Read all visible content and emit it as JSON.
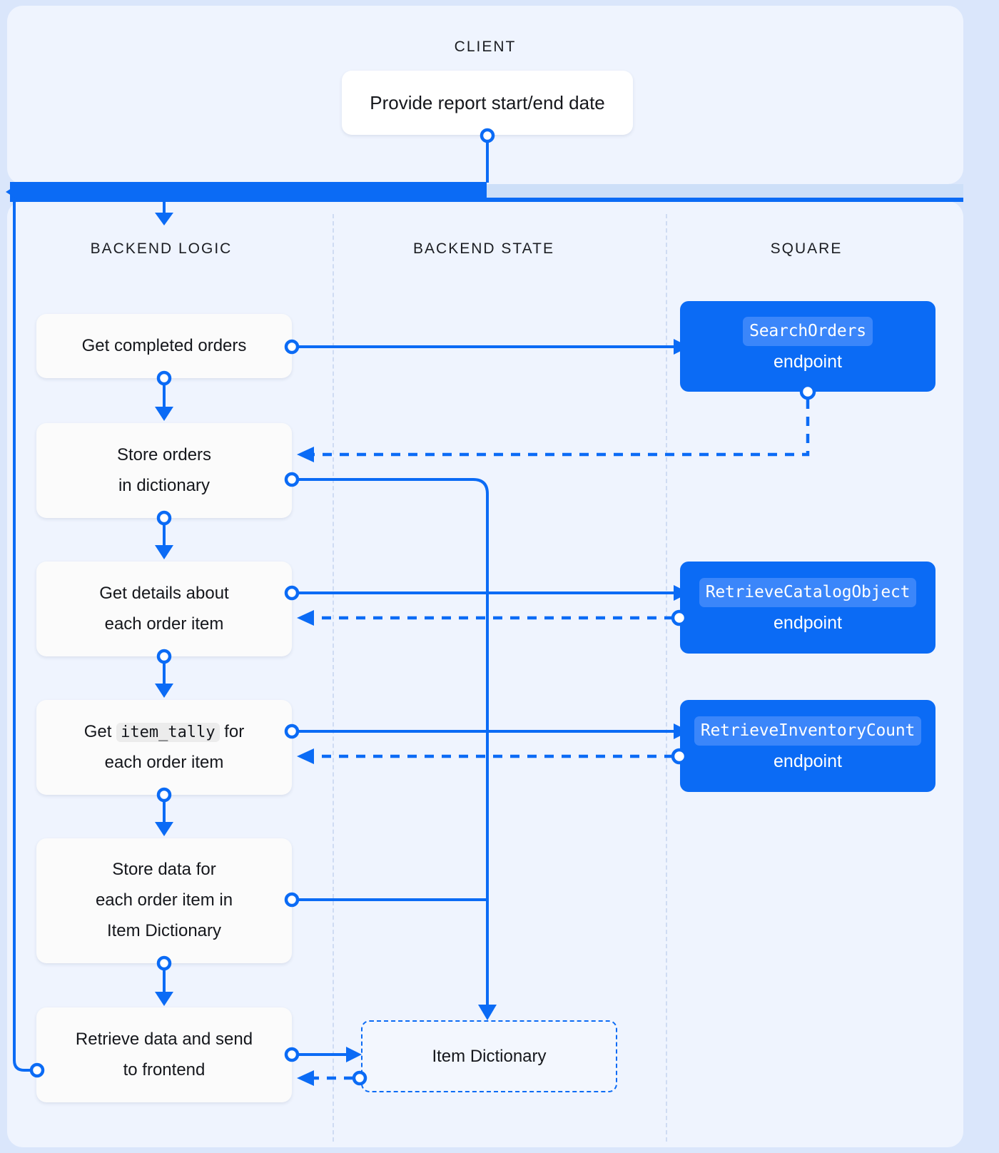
{
  "lanes": [
    {
      "id": "client",
      "label": "CLIENT"
    },
    {
      "id": "backend-logic",
      "label": "BACKEND LOGIC"
    },
    {
      "id": "backend-state",
      "label": "BACKEND STATE"
    },
    {
      "id": "square",
      "label": "SQUARE"
    }
  ],
  "client": {
    "node": {
      "label": "Provide report start/end date"
    }
  },
  "backend_logic": {
    "nodes": [
      {
        "id": "get-completed-orders",
        "label": "Get completed orders"
      },
      {
        "id": "store-orders",
        "line1": "Store orders",
        "line2": "in dictionary"
      },
      {
        "id": "get-item-details",
        "line1": "Get details about",
        "line2": "each order item"
      },
      {
        "id": "get-item-tally",
        "pre": "Get ",
        "code": "item_tally",
        "post": " for",
        "line2": "each order item"
      },
      {
        "id": "store-item-data",
        "line1": "Store data for",
        "line2": "each order item in",
        "line3": "Item Dictionary"
      },
      {
        "id": "retrieve-send",
        "line1": "Retrieve data and send",
        "line2": "to frontend"
      }
    ]
  },
  "backend_state": {
    "stores": [
      {
        "id": "item-dictionary",
        "label": "Item Dictionary"
      }
    ]
  },
  "square": {
    "endpoints": [
      {
        "id": "search-orders",
        "api": "SearchOrders",
        "sub": "endpoint"
      },
      {
        "id": "retrieve-catalog-object",
        "api": "RetrieveCatalogObject",
        "sub": "endpoint"
      },
      {
        "id": "retrieve-inventory-count",
        "api": "RetrieveInventoryCount",
        "sub": "endpoint"
      }
    ]
  },
  "colors": {
    "accent": "#0b6bf5",
    "accent_light": "#3b86fa",
    "panel_bg": "#eff4fe",
    "page_bg": "#dae6fb",
    "node_bg": "#fbfbfb",
    "divider": "#cfdcf3",
    "bar_light": "#cddff8"
  }
}
